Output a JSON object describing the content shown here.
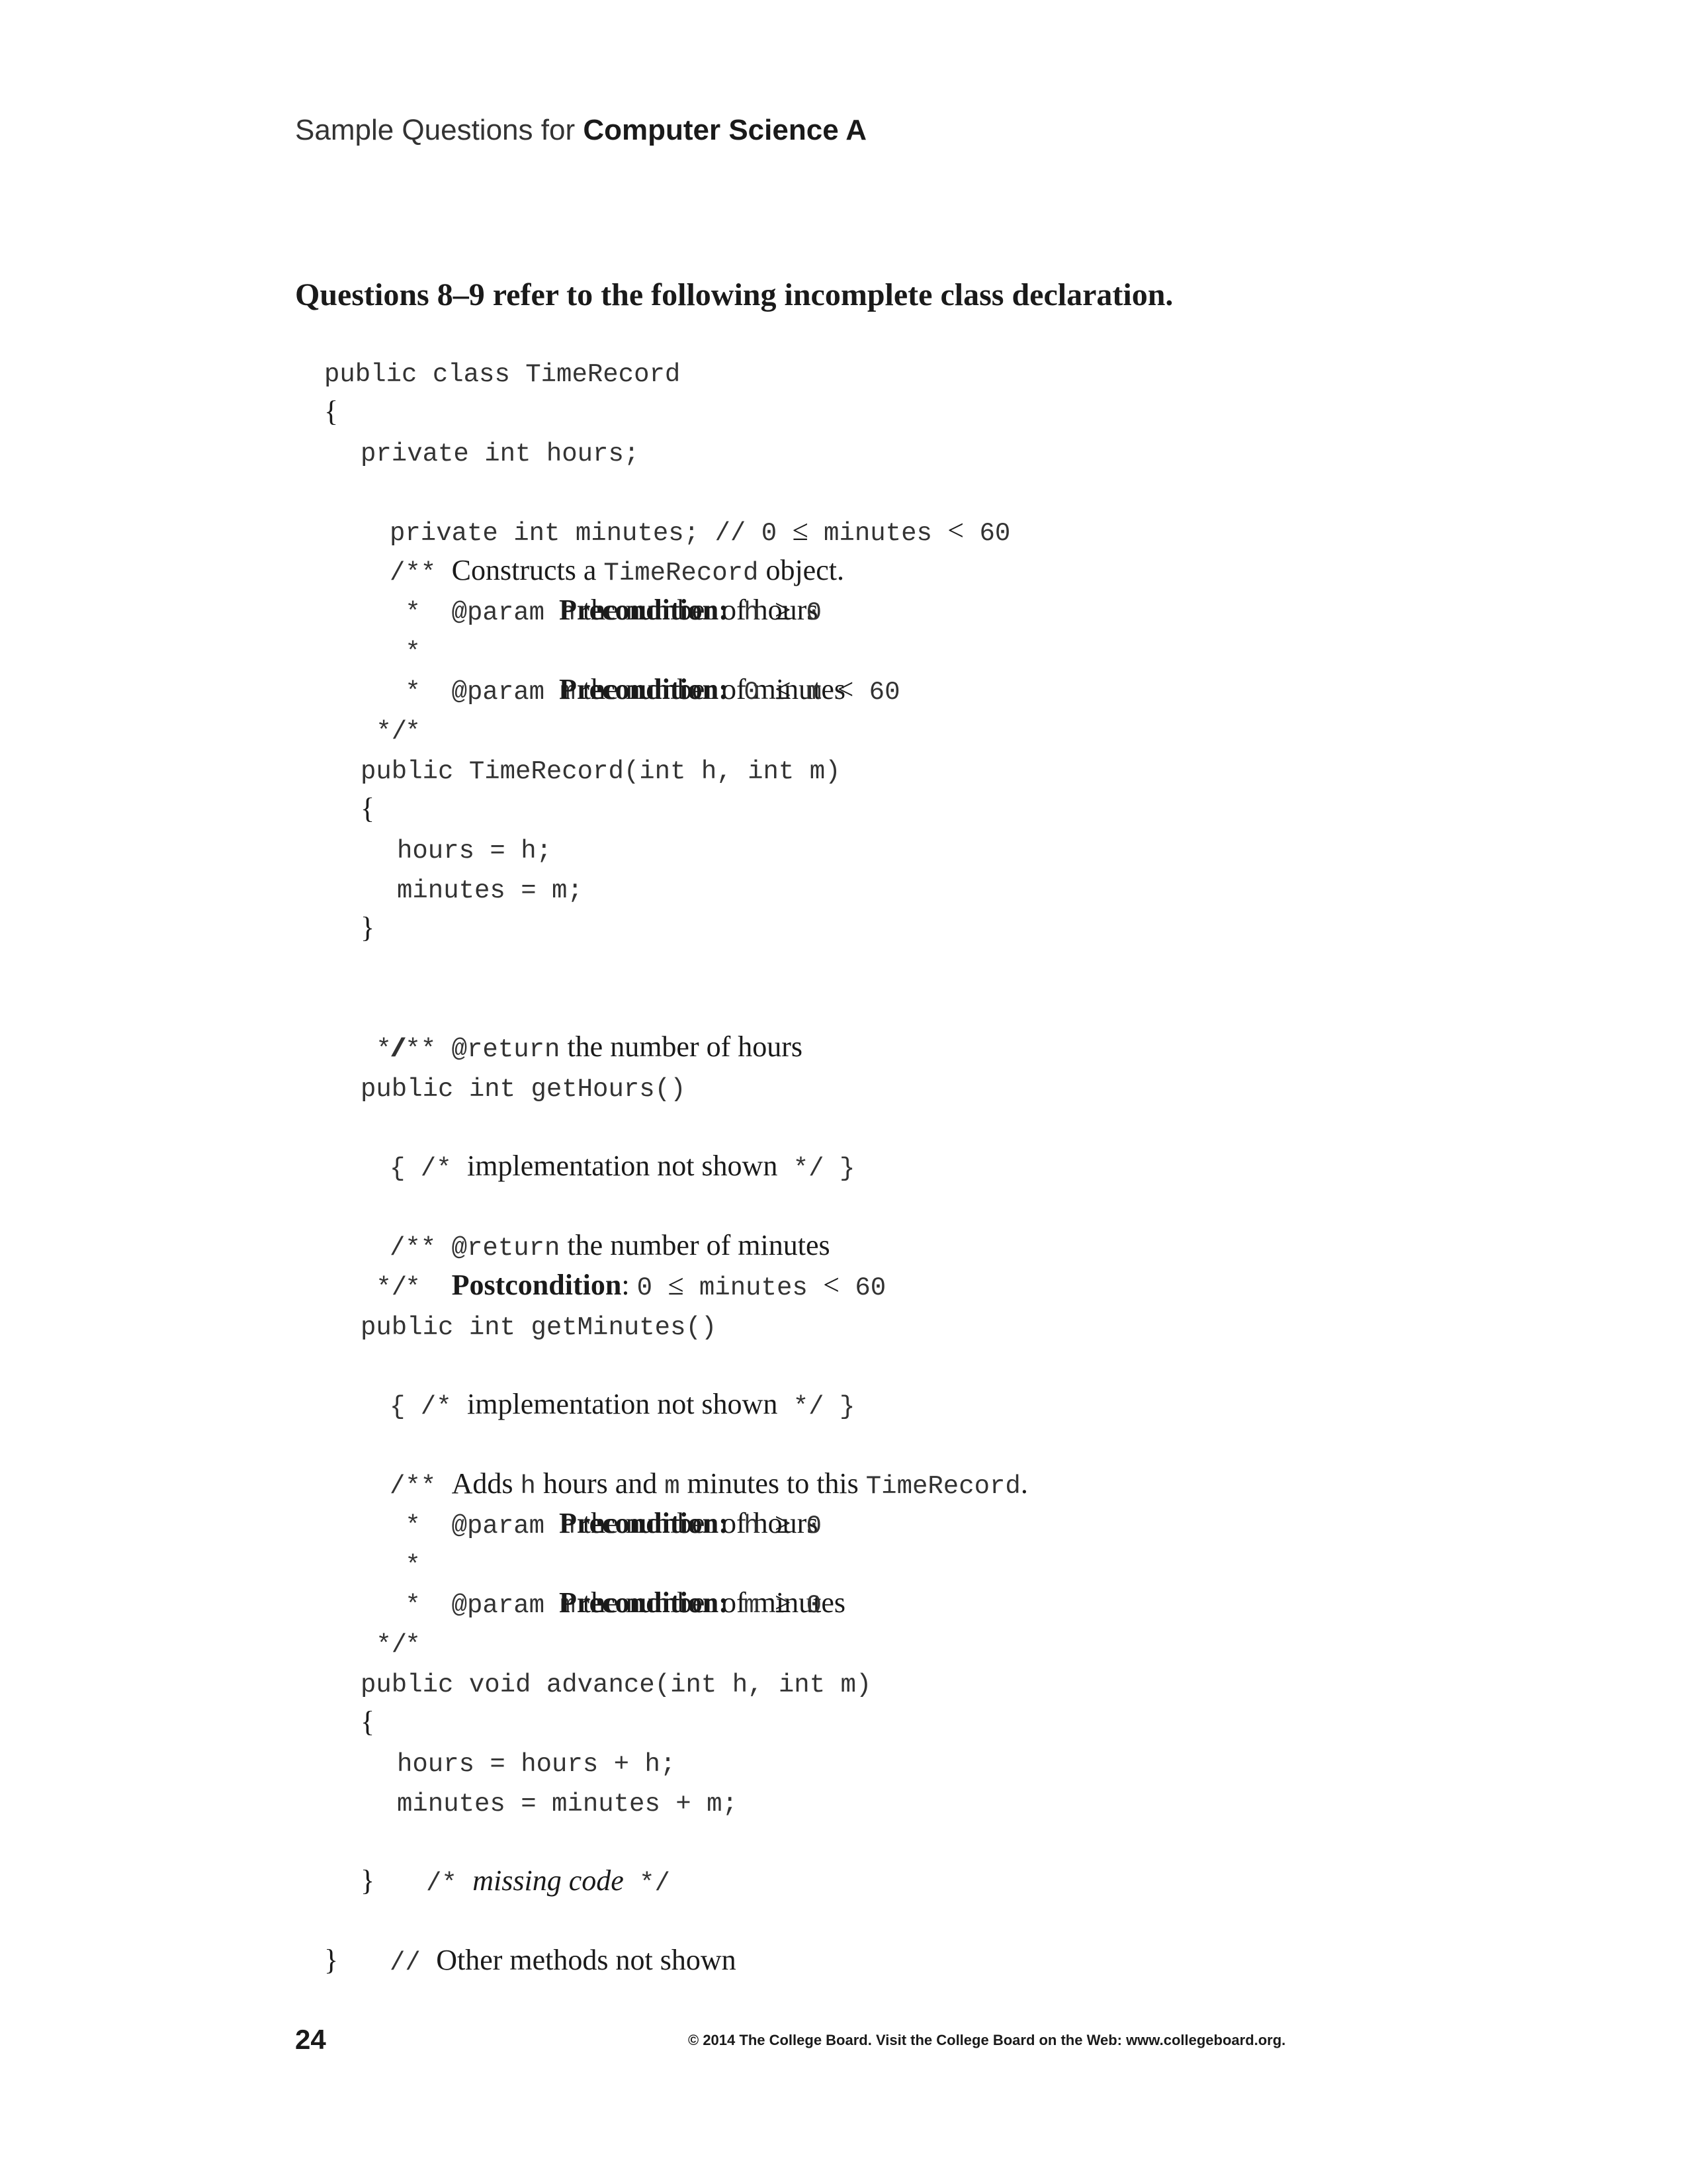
{
  "header": {
    "lead": "Sample Questions for",
    "strong": "Computer Science A"
  },
  "intro": "Questions 8–9 refer to the following incomplete class declaration.",
  "code": {
    "l1": "public class TimeRecord",
    "l2": "{",
    "l3": "private int hours;",
    "l4a": "private int minutes; // 0 ",
    "l4op1": "≤",
    "l4b": " minutes ",
    "l4op2": "<",
    "l4c": " 60",
    "l5a": "/** ",
    "l5b": "Constructs a ",
    "l5c": "TimeRecord",
    "l5d": " object.",
    "l6a": " *  @param h",
    "l6b": " the number of hours",
    "l7a": " *",
    "l7b": "Precondition:",
    "l7c": " h ",
    "l7op": "≥",
    "l7d": " 0",
    "l8a": " *  @param m",
    "l8b": " the number of minutes",
    "l9a": " *",
    "l9b": "Precondition:",
    "l9c": " 0 ",
    "l9op1": "≤",
    "l9d": " m ",
    "l9op2": "<",
    "l9e": " 60",
    "l10": " */",
    "l11": "public TimeRecord(int h, int m)",
    "l12": "{",
    "l13": "hours = h;",
    "l14": "minutes = m;",
    "l15": "}",
    "l16a": "/** @return",
    "l16b": " the number of hours",
    "l17": " */",
    "l18": "public int getHours()",
    "l19a": "{ /* ",
    "l19b": "implementation not shown",
    "l19c": " */ }",
    "l20a": "/** @return",
    "l20b": " the number of minutes",
    "l21a": " *  ",
    "l21b": "Postcondition",
    "l21c": ": ",
    "l21d": "0 ",
    "l21op1": "≤",
    "l21e": " minutes ",
    "l21op2": "<",
    "l21f": " 60",
    "l22": " */",
    "l23": "public int getMinutes()",
    "l24a": "{ /* ",
    "l24b": "implementation not shown",
    "l24c": " */ }",
    "l25a": "/** ",
    "l25b": "Adds ",
    "l25c": "h",
    "l25d": " hours and ",
    "l25e": "m",
    "l25f": " minutes to this ",
    "l25g": "TimeRecord",
    "l25h": ".",
    "l26a": " *  @param h",
    "l26b": " the number of hours",
    "l27a": " *",
    "l27b": "Precondition:",
    "l27c": " h ",
    "l27op": "≥",
    "l27d": " 0",
    "l28a": " *  @param m",
    "l28b": " the number of minutes",
    "l29a": " *",
    "l29b": "Precondition:",
    "l29c": " m ",
    "l29op": "≥",
    "l29d": " 0",
    "l30": " */",
    "l31": "public void advance(int h, int m)",
    "l32": "{",
    "l33": "hours = hours + h;",
    "l34": "minutes = minutes + m;",
    "l35a": "/* ",
    "l35b": "missing code",
    "l35c": " */",
    "l36": "}",
    "l37a": "// ",
    "l37b": "Other methods not shown",
    "l38": "}"
  },
  "footer": {
    "page_number": "24",
    "copyright": "© 2014 The College Board. Visit the College Board on the Web: www.collegeboard.org."
  }
}
